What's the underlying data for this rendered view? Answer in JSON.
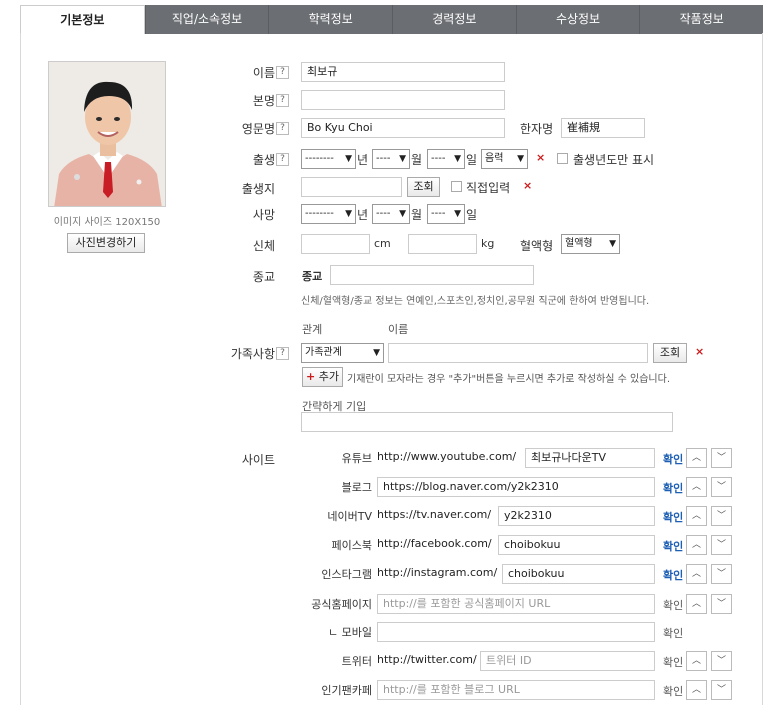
{
  "tabs": [
    "기본정보",
    "직업/소속정보",
    "학력정보",
    "경력정보",
    "수상정보",
    "작품정보"
  ],
  "photo": {
    "caption": "이미지 사이즈 120X150",
    "change_label": "사진변경하기"
  },
  "form": {
    "help_mark": "?",
    "name": {
      "label": "이름",
      "value": "최보규"
    },
    "real_name": {
      "label": "본명",
      "value": ""
    },
    "english_name": {
      "label": "영문명",
      "value": "Bo Kyu Choi"
    },
    "hanja": {
      "label": "한자명",
      "value": "崔補規"
    },
    "birth": {
      "label": "출생",
      "year": "--------",
      "year_unit": "년",
      "month": "----",
      "month_unit": "월",
      "day": "----",
      "day_unit": "일",
      "calendar": "음력",
      "year_only_label": "출생년도만 표시"
    },
    "birthplace": {
      "label": "출생지",
      "value": "",
      "search_label": "조회",
      "direct_label": "직접입력"
    },
    "death": {
      "label": "사망",
      "year": "--------",
      "year_unit": "년",
      "month": "----",
      "month_unit": "월",
      "day": "----",
      "day_unit": "일"
    },
    "body": {
      "label": "신체",
      "cm_unit": "cm",
      "kg_unit": "kg",
      "blood_label": "혈액형",
      "blood_value": "혈액형"
    },
    "religion": {
      "label": "종교",
      "inner_label": "종교",
      "value": "",
      "note": "신체/혈액형/종교 정보는 연예인,스포츠인,정치인,공무원 직군에 한하여 반영됩니다."
    },
    "family": {
      "label": "가족사항",
      "col_relation": "관계",
      "col_name": "이름",
      "relation_value": "가족관계",
      "name_value": "",
      "search_label": "조회",
      "add_label": "추가",
      "add_note": "기재란이 모자라는 경우 \"추가\"버튼을 누르시면 추가로 작성하실 수 있습니다.",
      "brief_label": "간략하게 기입",
      "brief_value": ""
    },
    "site": {
      "label": "사이트",
      "rows": [
        {
          "name": "유튜브",
          "prefix": "http://www.youtube.com/",
          "value": "최보규나다운TV",
          "placeholder": "",
          "confirm": "확인",
          "active": true,
          "arrows": true
        },
        {
          "name": "블로그",
          "prefix": "",
          "value": "https://blog.naver.com/y2k2310",
          "placeholder": "",
          "confirm": "확인",
          "active": true,
          "arrows": true
        },
        {
          "name": "네이버TV",
          "prefix": "https://tv.naver.com/",
          "value": "y2k2310",
          "placeholder": "",
          "confirm": "확인",
          "active": true,
          "arrows": true
        },
        {
          "name": "페이스북",
          "prefix": "http://facebook.com/",
          "value": "choibokuu",
          "placeholder": "",
          "confirm": "확인",
          "active": true,
          "arrows": true
        },
        {
          "name": "인스타그램",
          "prefix": "http://instagram.com/",
          "value": "choibokuu",
          "placeholder": "",
          "confirm": "확인",
          "active": true,
          "arrows": true
        },
        {
          "name": "공식홈페이지",
          "prefix": "",
          "value": "",
          "placeholder": "http://를 포함한 공식홈페이지 URL",
          "confirm": "확인",
          "active": false,
          "arrows": true
        },
        {
          "name": "ㄴ 모바일",
          "prefix": "",
          "value": "",
          "placeholder": "",
          "confirm": "확인",
          "active": false,
          "arrows": false
        },
        {
          "name": "트위터",
          "prefix": "http://twitter.com/",
          "value": "",
          "placeholder": "트위터 ID",
          "confirm": "확인",
          "active": false,
          "arrows": true
        },
        {
          "name": "인기팬카페",
          "prefix": "",
          "value": "",
          "placeholder": "http://를 포함한 블로그 URL",
          "confirm": "확인",
          "active": false,
          "arrows": true
        }
      ],
      "up_glyph": "︿",
      "down_glyph": "﹀"
    },
    "mark_x": "×",
    "add_plus": "+"
  }
}
